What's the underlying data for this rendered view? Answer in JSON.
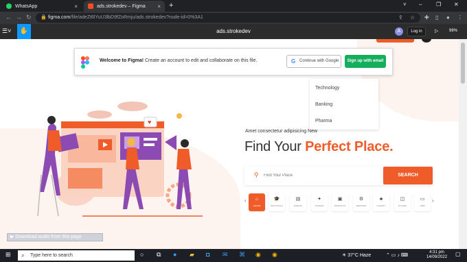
{
  "browser": {
    "tabs": [
      {
        "title": "WhatsApp",
        "close": "×"
      },
      {
        "title": "ads.strokedev – Figma",
        "close": "×"
      }
    ],
    "new_tab": "+",
    "window_controls": [
      "˅",
      "–",
      "❐",
      "✕"
    ],
    "url_host": "figma.com",
    "url_path": "/file/adeZt6lYuU3lbD9fZoRmju/ads.strokedev?node-id=0%3A1"
  },
  "figma": {
    "file_title": "ads.strokedev",
    "avatar_letter": "A",
    "login_label": "Log in",
    "zoom": "98%"
  },
  "welcome": {
    "title": "Welcome to Figma!",
    "message": "Create an account to edit and collaborate on this file.",
    "google_label": "Continue with Google",
    "email_label": "Sign up with email"
  },
  "dropdown": {
    "items": [
      "Technology",
      "Banking",
      "Pharma"
    ]
  },
  "hero": {
    "tagline": "Amet consectetur adipisicing New",
    "headline_plain": "Find Your",
    "headline_highlight": "Perfect Place.",
    "search_placeholder": "Find Your Place",
    "search_button": "SEARCH"
  },
  "categories": [
    {
      "icon": "⌂",
      "label": "HOUSE"
    },
    {
      "icon": "🎓",
      "label": "EDUCATION"
    },
    {
      "icon": "▤",
      "label": "EVENTS"
    },
    {
      "icon": "✦",
      "label": "FITNESS"
    },
    {
      "icon": "▣",
      "label": "PRODUCTS"
    },
    {
      "icon": "⚙",
      "label": "SERVICES"
    },
    {
      "icon": "♣",
      "label": "CHARITY"
    },
    {
      "icon": "◫",
      "label": "PLACES"
    },
    {
      "icon": "▭",
      "label": "JOBS"
    }
  ],
  "download_bar": "Download audio from this page",
  "taskbar": {
    "search_placeholder": "Type here to search",
    "weather": "37°C  Haze",
    "time": "4:31 pm",
    "date": "14/09/2022"
  },
  "colors": {
    "accent": "#ef5c2a",
    "figma_blue": "#0d99ff",
    "green": "#14ae5c"
  }
}
